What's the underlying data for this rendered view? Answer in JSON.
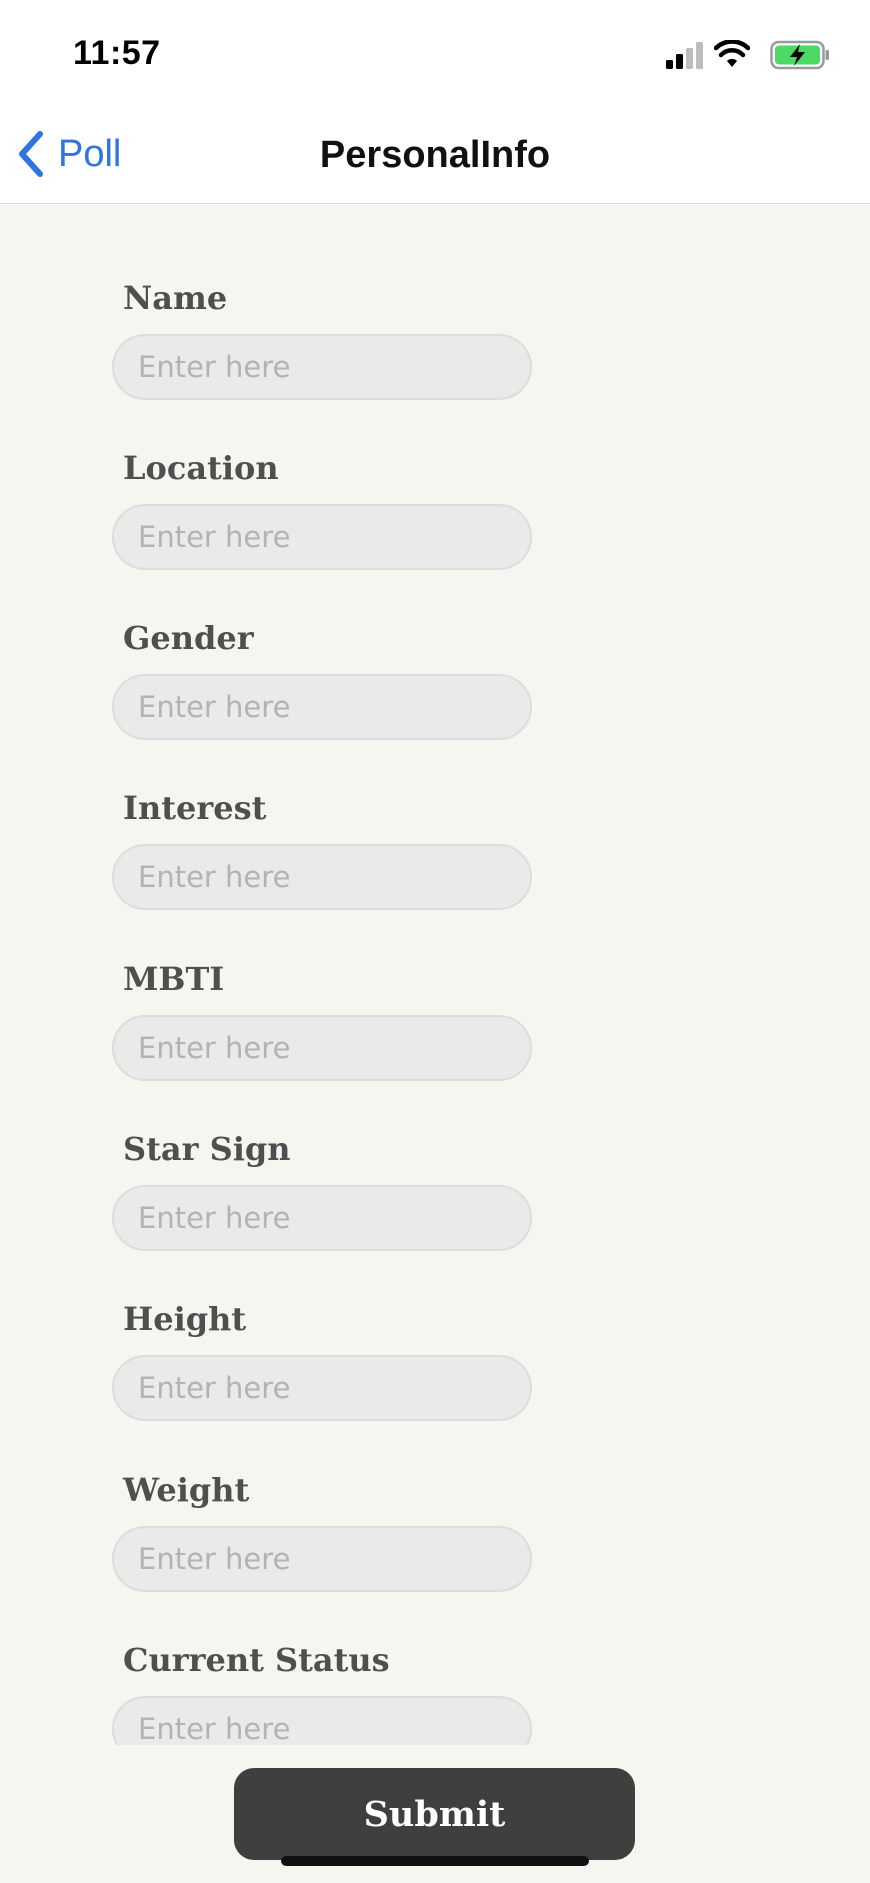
{
  "status_bar": {
    "time": "11:57",
    "icons": [
      "signal-icon",
      "wifi-icon",
      "battery-charging-icon"
    ],
    "battery_color": "#4cd964"
  },
  "nav": {
    "back_label": "Poll",
    "title": "PersonalInfo",
    "accent_color": "#2f74e0"
  },
  "form": {
    "fields": [
      {
        "label": "Name",
        "placeholder": "Enter here",
        "value": ""
      },
      {
        "label": "Location",
        "placeholder": "Enter here",
        "value": ""
      },
      {
        "label": "Gender",
        "placeholder": "Enter here",
        "value": ""
      },
      {
        "label": "Interest",
        "placeholder": "Enter here",
        "value": ""
      },
      {
        "label": "MBTI",
        "placeholder": "Enter here",
        "value": ""
      },
      {
        "label": "Star Sign",
        "placeholder": "Enter here",
        "value": ""
      },
      {
        "label": "Height",
        "placeholder": "Enter here",
        "value": ""
      },
      {
        "label": "Weight",
        "placeholder": "Enter here",
        "value": ""
      },
      {
        "label": "Current Status",
        "placeholder": "Enter here",
        "value": ""
      }
    ]
  },
  "submit": {
    "label": "Submit"
  }
}
